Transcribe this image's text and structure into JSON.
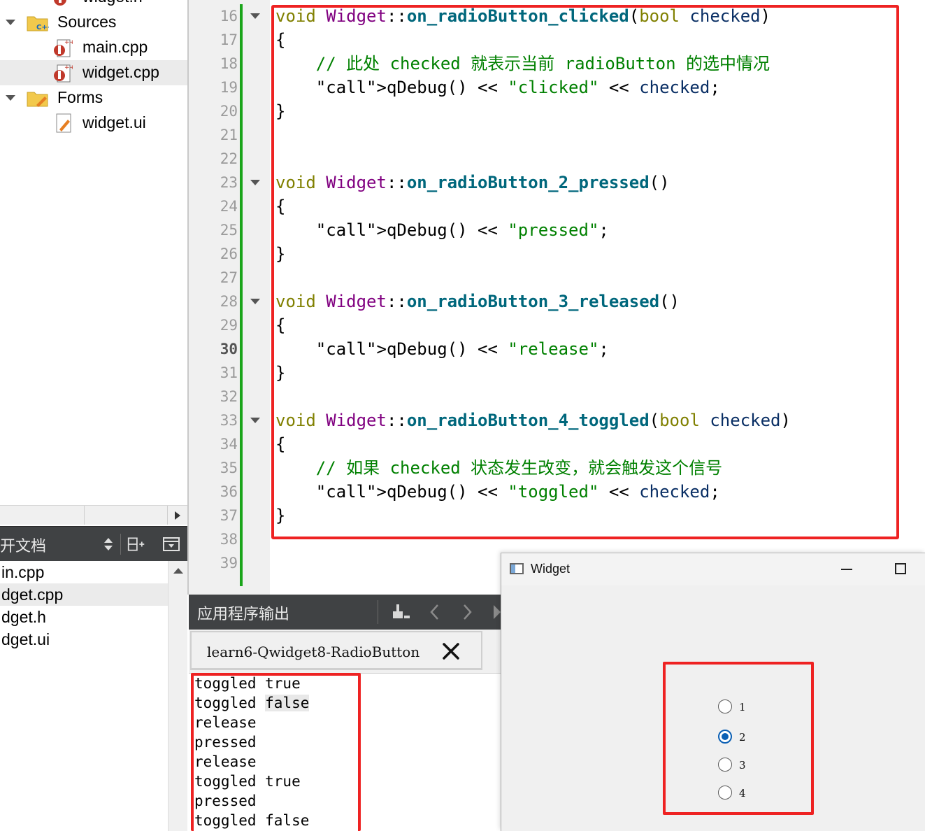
{
  "project_tree": {
    "items": [
      {
        "label": "widget.h",
        "type": "file-header"
      },
      {
        "label": "Sources",
        "type": "folder"
      },
      {
        "label": "main.cpp",
        "type": "file-cpp"
      },
      {
        "label": "widget.cpp",
        "type": "file-cpp",
        "selected": true
      },
      {
        "label": "Forms",
        "type": "folder"
      },
      {
        "label": "widget.ui",
        "type": "file-ui"
      }
    ]
  },
  "open_docs": {
    "title": "开文档",
    "files": [
      "in.cpp",
      "dget.cpp",
      "dget.h",
      "dget.ui"
    ],
    "selected_index": 1
  },
  "editor": {
    "current_line": "30",
    "lines": [
      {
        "n": "16",
        "text": "void Widget::on_radioButton_clicked(bool checked)"
      },
      {
        "n": "17",
        "text": "{"
      },
      {
        "n": "18",
        "text": "    // 此处 checked 就表示当前 radioButton 的选中情况"
      },
      {
        "n": "19",
        "text": "    qDebug() << \"clicked\" << checked;"
      },
      {
        "n": "20",
        "text": "}"
      },
      {
        "n": "21",
        "text": ""
      },
      {
        "n": "22",
        "text": ""
      },
      {
        "n": "23",
        "text": "void Widget::on_radioButton_2_pressed()"
      },
      {
        "n": "24",
        "text": "{"
      },
      {
        "n": "25",
        "text": "    qDebug() << \"pressed\";"
      },
      {
        "n": "26",
        "text": "}"
      },
      {
        "n": "27",
        "text": ""
      },
      {
        "n": "28",
        "text": "void Widget::on_radioButton_3_released()"
      },
      {
        "n": "29",
        "text": "{"
      },
      {
        "n": "30",
        "text": "    qDebug() << \"release\";"
      },
      {
        "n": "31",
        "text": "}"
      },
      {
        "n": "32",
        "text": ""
      },
      {
        "n": "33",
        "text": "void Widget::on_radioButton_4_toggled(bool checked)"
      },
      {
        "n": "34",
        "text": "{"
      },
      {
        "n": "35",
        "text": "    // 如果 checked 状态发生改变，就会触发这个信号"
      },
      {
        "n": "36",
        "text": "    qDebug() << \"toggled\" << checked;"
      },
      {
        "n": "37",
        "text": "}"
      },
      {
        "n": "38",
        "text": ""
      },
      {
        "n": "39",
        "text": ""
      }
    ]
  },
  "output": {
    "title": "应用程序输出",
    "tab_label": "learn6-Qwidget8-RadioButton",
    "lines": [
      "toggled true",
      "toggled false",
      "release",
      "pressed",
      "release",
      "toggled true",
      "pressed",
      "toggled false"
    ]
  },
  "widget_window": {
    "title": "Widget",
    "radios": [
      {
        "label": "1",
        "checked": false
      },
      {
        "label": "2",
        "checked": true
      },
      {
        "label": "3",
        "checked": false
      },
      {
        "label": "4",
        "checked": false
      }
    ]
  },
  "colors": {
    "highlight": "#ee2222",
    "change_bar": "#1aa51a",
    "pane_header": "#404244",
    "radio_accent": "#0a5fb4"
  }
}
